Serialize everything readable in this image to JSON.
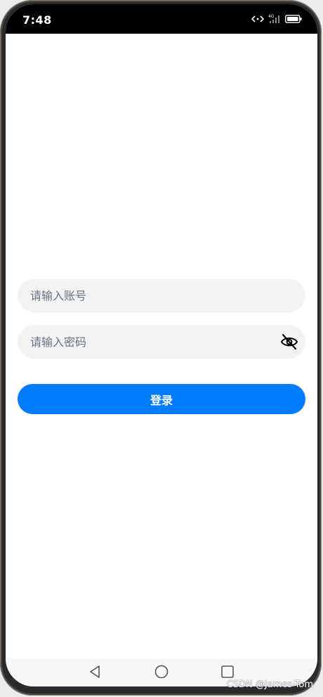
{
  "status_bar": {
    "time": "7:48",
    "network_label": "4G",
    "icons": [
      "hotspot-icon",
      "signal-icon",
      "battery-icon"
    ]
  },
  "login_form": {
    "account_placeholder": "请输入账号",
    "account_value": "",
    "password_placeholder": "请输入密码",
    "password_value": "",
    "password_toggle_icon": "eye-off-icon",
    "login_label": "登录"
  },
  "nav_bar": {
    "icons": [
      "back-triangle-icon",
      "home-circle-icon",
      "recent-square-icon"
    ]
  },
  "watermark": "CSDN @James-Tom",
  "colors": {
    "primary": "#007dff",
    "input_background": "#f1f3f5",
    "screen_background": "#ffffff",
    "status_bar_background": "#000000"
  }
}
